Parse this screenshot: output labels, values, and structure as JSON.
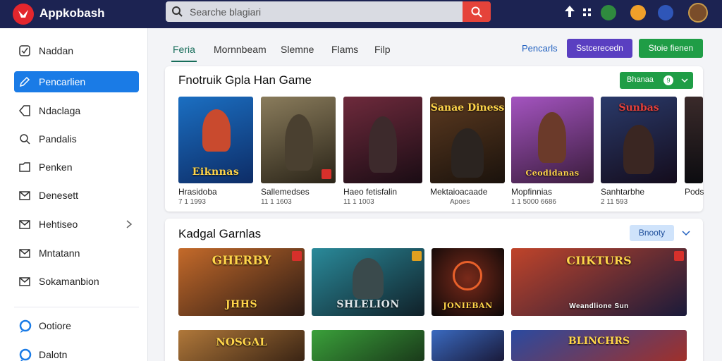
{
  "app": {
    "title": "Appkobash"
  },
  "search": {
    "placeholder": "Searche blagiari"
  },
  "sidebar": {
    "items": [
      {
        "label": "Naddan",
        "icon": "checkbox-icon"
      },
      {
        "label": "Pencarlien",
        "icon": "pencil-icon",
        "active": true
      },
      {
        "label": "Ndaclaga",
        "icon": "tag-icon"
      },
      {
        "label": "Pandalis",
        "icon": "search-icon"
      },
      {
        "label": "Penken",
        "icon": "folder-icon"
      },
      {
        "label": "Denesett",
        "icon": "mail-icon"
      },
      {
        "label": "Hehtiseo",
        "icon": "mail-icon"
      },
      {
        "label": "Mntatann",
        "icon": "mail-icon"
      },
      {
        "label": "Sokamanbion",
        "icon": "mail-icon"
      },
      {
        "label": "Ootiore",
        "icon": "chat-icon"
      },
      {
        "label": "Dalotn",
        "icon": "chat-icon"
      }
    ]
  },
  "tabs": [
    {
      "label": "Feria",
      "active": true
    },
    {
      "label": "Mornnbeam"
    },
    {
      "label": "Slemne"
    },
    {
      "label": "Flams"
    },
    {
      "label": "Filp"
    }
  ],
  "toolbar": {
    "link_label": "Pencarls",
    "primary_label": "Sstcerecedn",
    "secondary_label": "Stoie fienen"
  },
  "featured": {
    "title": "Fnotruik Gpla Han Game",
    "filter_label": "Bhanaa",
    "filter_count": "9",
    "games": [
      {
        "name": "Hrasidoba",
        "meta": "7 1 1993",
        "art": "Eiknnas"
      },
      {
        "name": "Sallemedses",
        "meta": "11 1 1603",
        "art": ""
      },
      {
        "name": "Haeo fetisfalin",
        "meta": "11 1 1003",
        "art": ""
      },
      {
        "name": "Mektaioacaade",
        "meta": "Apoes",
        "art": "Sanae Diness"
      },
      {
        "name": "Mopfinnias",
        "meta": "1 1 5000 6686",
        "art": "Ceodidanas"
      },
      {
        "name": "Sanhtarbhe",
        "meta": "2 11 593",
        "art": "Sunbas"
      },
      {
        "name": "Pods",
        "meta": "",
        "art": ""
      }
    ]
  },
  "catalog": {
    "title": "Kadgal Garnlas",
    "sort_label": "Bnooty",
    "tiles": [
      {
        "art_top": "GHERBY",
        "art_bottom": "JHHS"
      },
      {
        "art_top": "",
        "art_bottom": "SHLELION"
      },
      {
        "art_top": "",
        "art_bottom": "JONIEBAN"
      },
      {
        "art_top": "CIIKTURS",
        "art_bottom": "Weandlione Sun"
      },
      {
        "art_top": "NOSGAL",
        "art_bottom": ""
      },
      {
        "art_top": "",
        "art_bottom": ""
      },
      {
        "art_top": "",
        "art_bottom": ""
      },
      {
        "art_top": "BLINCHRS",
        "art_bottom": ""
      }
    ]
  },
  "colors": {
    "topbar": "#1c2352",
    "accent_blue": "#1a7be6",
    "accent_green": "#1f9d46",
    "accent_purple": "#5a3fc1",
    "search_button": "#e5433a"
  }
}
